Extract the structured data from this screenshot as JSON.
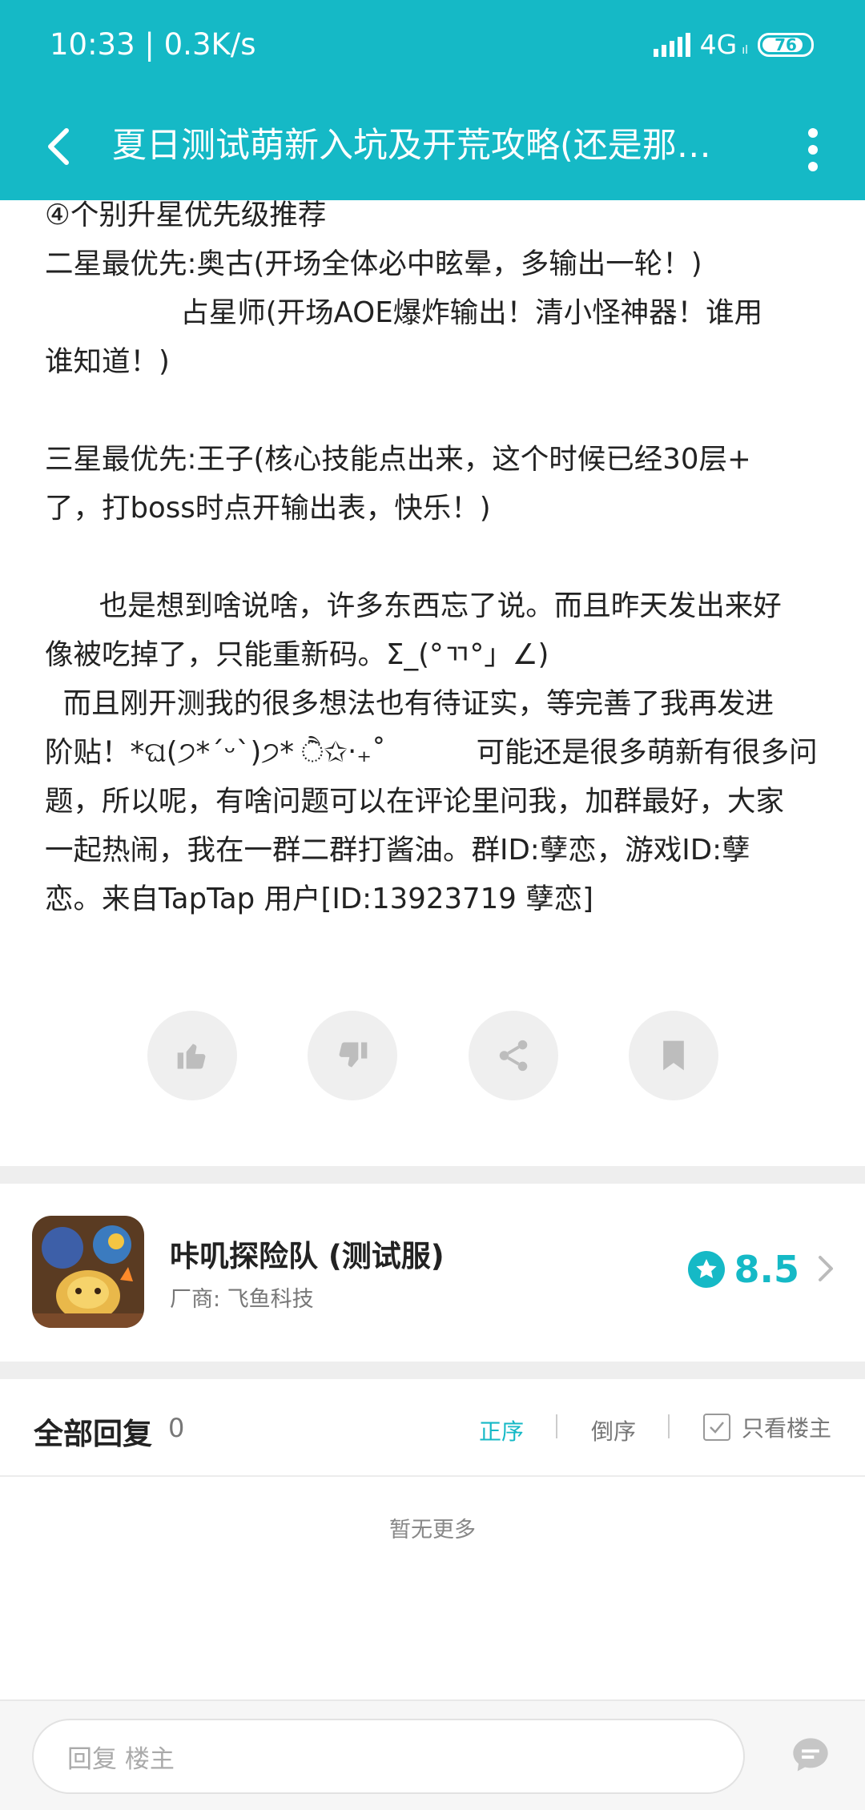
{
  "status_bar": {
    "time": "10:33",
    "speed": "0.3K/s",
    "network": "4G",
    "network_sub": "ıl",
    "battery": "76"
  },
  "header": {
    "title": "夏日测试萌新入坑及开荒攻略(还是那条…",
    "back_icon": "chevron-left-icon",
    "more_icon": "more-vertical-icon"
  },
  "article": {
    "lines": [
      "④个别升星优先级推荐",
      "二星最优先:奥古(开场全体必中眩晕，多输出一轮！)",
      "               占星师(开场AOE爆炸输出！清小怪神器！谁用",
      "谁知道！)",
      "",
      "三星最优先:王子(核心技能点出来，这个时候已经30层+",
      "了，打boss时点开输出表，快乐！)",
      "",
      "      也是想到啥说啥，许多东西忘了说。而且昨天发出来好",
      "像被吃掉了，只能重新码。Σ_(°ㄲ°」∠)",
      "  而且刚开测我的很多想法也有待证实，等完善了我再发进",
      "阶贴！*ଘ(੭*ˊᵕˋ)੭* ੈ✩‧₊˚          可能还是很多萌新有很多问",
      "题，所以呢，有啥问题可以在评论里问我，加群最好，大家",
      "一起热闹，我在一群二群打酱油。群ID:孽恋，游戏ID:孽",
      "恋。来自TapTap 用户[ID:13923719 孽恋]"
    ]
  },
  "actions": {
    "like_icon": "thumbs-up-icon",
    "dislike_icon": "thumbs-down-icon",
    "share_icon": "share-icon",
    "bookmark_icon": "bookmark-icon"
  },
  "game": {
    "name": "咔叽探险队 (测试服)",
    "vendor": "厂商: 飞鱼科技",
    "rating": "8.5",
    "rating_icon": "star-icon"
  },
  "replies": {
    "title": "全部回复",
    "count": "0",
    "sort_asc": "正序",
    "sort_desc": "倒序",
    "only_op": "只看楼主",
    "empty": "暂无更多"
  },
  "reply_bar": {
    "placeholder": "回复  楼主",
    "icon": "comment-icon"
  },
  "colors": {
    "accent": "#15b9c6",
    "background": "#ffffff",
    "band": "#eeeeee"
  }
}
